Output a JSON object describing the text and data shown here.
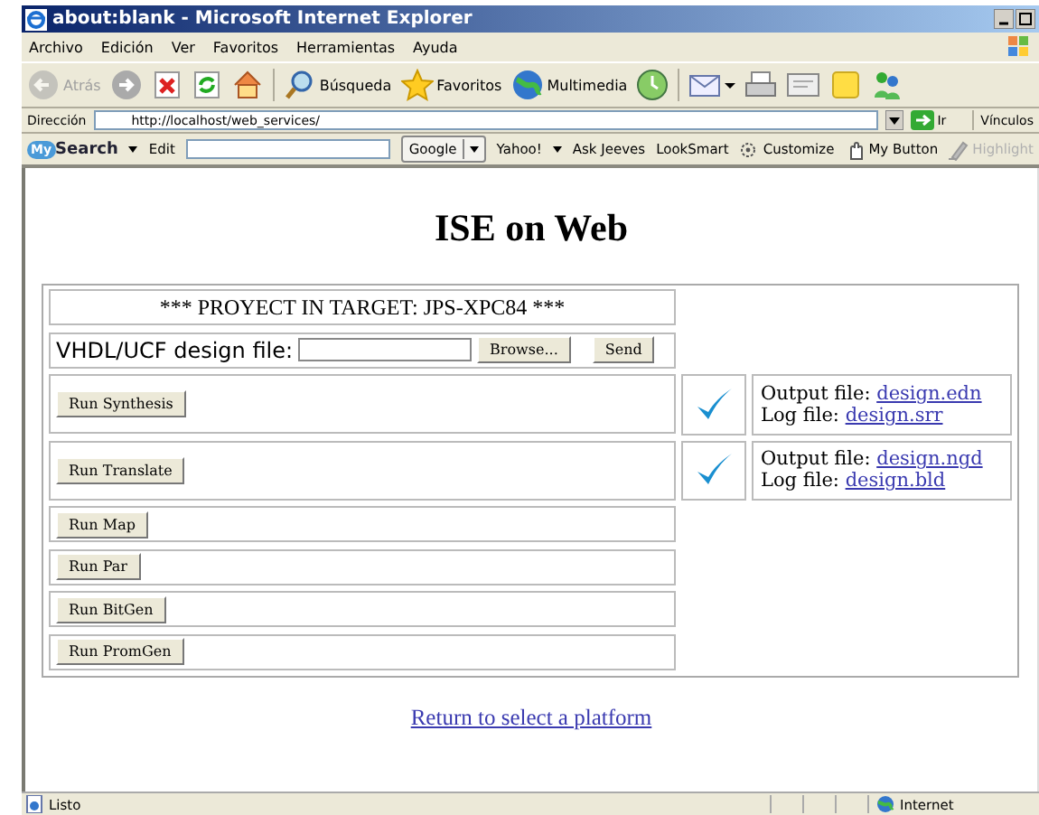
{
  "window": {
    "title": "about:blank - Microsoft Internet Explorer"
  },
  "menu": [
    "Archivo",
    "Edición",
    "Ver",
    "Favoritos",
    "Herramientas",
    "Ayuda"
  ],
  "toolbar": [
    {
      "kind": "back",
      "label": "Atrás",
      "disabled": true
    },
    {
      "kind": "forward"
    },
    {
      "kind": "stop"
    },
    {
      "kind": "refresh"
    },
    {
      "kind": "home"
    },
    {
      "kind": "search",
      "label": "Búsqueda"
    },
    {
      "kind": "favorites",
      "label": "Favoritos"
    },
    {
      "kind": "media",
      "label": "Multimedia"
    },
    {
      "kind": "history"
    },
    {
      "kind": "mail"
    },
    {
      "kind": "print"
    },
    {
      "kind": "edit"
    },
    {
      "kind": "note"
    },
    {
      "kind": "messenger"
    }
  ],
  "address": {
    "label": "Dirección",
    "value": "http://localhost/web_services/",
    "go": "Ir",
    "links": "Vínculos"
  },
  "search_bar": {
    "badge": "My",
    "brand": "Search",
    "edit": "Edit",
    "engine": "Google",
    "items": [
      {
        "kind": "menu",
        "label": "Yahoo!"
      },
      {
        "kind": "plain",
        "label": "Ask Jeeves"
      },
      {
        "kind": "plain",
        "label": "LookSmart"
      },
      {
        "kind": "customize",
        "label": "Customize"
      },
      {
        "kind": "hand",
        "label": "My Button"
      },
      {
        "kind": "pen",
        "label": "Highlight",
        "disabled": true
      }
    ]
  },
  "page": {
    "heading": "ISE on Web",
    "target": "*** PROYECT IN TARGET: JPS-XPC84 ***",
    "upload": {
      "label": "VHDL/UCF design file:",
      "browse": "Browse...",
      "send": "Send"
    },
    "steps": [
      {
        "button": "Run Synthesis",
        "done": true,
        "output_label": "Output file:",
        "output_file": "design.edn",
        "log_label": "Log file:",
        "log_file": "design.srr"
      },
      {
        "button": "Run Translate",
        "done": true,
        "output_label": "Output file:",
        "output_file": "design.ngd",
        "log_label": "Log file:",
        "log_file": "design.bld"
      },
      {
        "button": "Run Map",
        "done": false
      },
      {
        "button": "Run Par",
        "done": false
      },
      {
        "button": "Run BitGen",
        "done": false
      },
      {
        "button": "Run PromGen",
        "done": false
      }
    ],
    "link": "Return to select a platform"
  },
  "status_bar": {
    "text": "Listo",
    "zone": "Internet"
  }
}
